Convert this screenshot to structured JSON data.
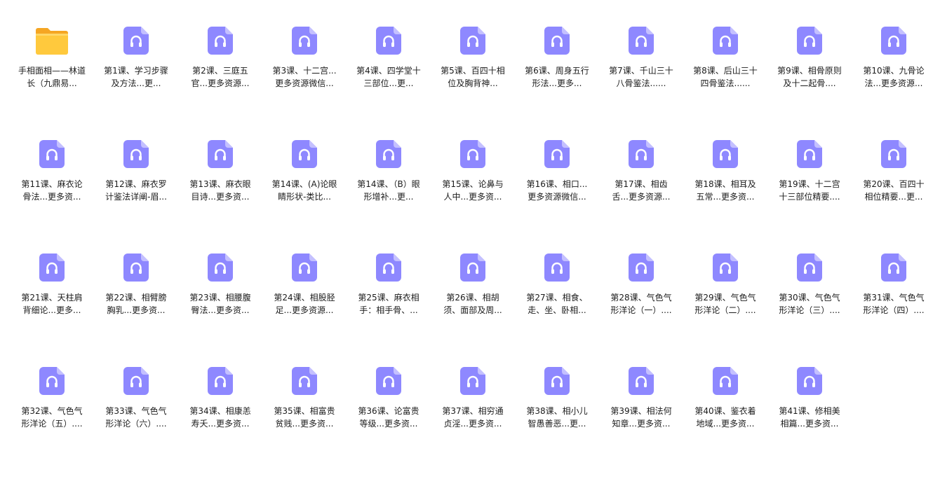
{
  "files": [
    {
      "name": "手相面相——林道长（九鼎易...",
      "icon": "folder-icon"
    },
    {
      "name": "第1课、学习步骤及方法...更...",
      "icon": "audio-file-icon"
    },
    {
      "name": "第2课、三庭五官...更多资源...",
      "icon": "audio-file-icon"
    },
    {
      "name": "第3课、十二宫...更多资源微信...",
      "icon": "audio-file-icon"
    },
    {
      "name": "第4课、四学堂十三部位...更...",
      "icon": "audio-file-icon"
    },
    {
      "name": "第5课、百四十相位及胸背神...",
      "icon": "audio-file-icon"
    },
    {
      "name": "第6课、周身五行形法...更多...",
      "icon": "audio-file-icon"
    },
    {
      "name": "第7课、千山三十八骨鉴法......",
      "icon": "audio-file-icon"
    },
    {
      "name": "第8课、后山三十四骨鉴法......",
      "icon": "audio-file-icon"
    },
    {
      "name": "第9课、相骨原则及十二起骨....",
      "icon": "audio-file-icon"
    },
    {
      "name": "第10课、九骨论法...更多资源...",
      "icon": "audio-file-icon"
    },
    {
      "name": "第11课、麻衣论骨法...更多资...",
      "icon": "audio-file-icon"
    },
    {
      "name": "第12课、麻衣罗计鉴法详阐-眉...",
      "icon": "audio-file-icon"
    },
    {
      "name": "第13课、麻衣眼目诗...更多资...",
      "icon": "audio-file-icon"
    },
    {
      "name": "第14课、(A)论眼睛形状-类比...",
      "icon": "audio-file-icon"
    },
    {
      "name": "第14课、（B）眼形增补...更...",
      "icon": "audio-file-icon"
    },
    {
      "name": "第15课、论鼻与人中...更多资...",
      "icon": "audio-file-icon"
    },
    {
      "name": "第16课、相口...更多资源微信...",
      "icon": "audio-file-icon"
    },
    {
      "name": "第17课、相齿舌...更多资源...",
      "icon": "audio-file-icon"
    },
    {
      "name": "第18课、相耳及五常...更多资...",
      "icon": "audio-file-icon"
    },
    {
      "name": "第19课、十二宫十三部位精要....",
      "icon": "audio-file-icon"
    },
    {
      "name": "第20课、百四十相位精要...更...",
      "icon": "audio-file-icon"
    },
    {
      "name": "第21课、天柱肩背细论...更多...",
      "icon": "audio-file-icon"
    },
    {
      "name": "第22课、相臂膀胸乳...更多资...",
      "icon": "audio-file-icon"
    },
    {
      "name": "第23课、相腰腹臀法...更多资...",
      "icon": "audio-file-icon"
    },
    {
      "name": "第24课、相股胫足...更多资源...",
      "icon": "audio-file-icon"
    },
    {
      "name": "第25课、麻衣相手：相手骨、...",
      "icon": "audio-file-icon"
    },
    {
      "name": "第26课、相胡须、面部及周...",
      "icon": "audio-file-icon"
    },
    {
      "name": "第27课、相食、走、坐、卧相...",
      "icon": "audio-file-icon"
    },
    {
      "name": "第28课、气色气形洋论（一）....",
      "icon": "audio-file-icon"
    },
    {
      "name": "第29课、气色气形洋论（二）....",
      "icon": "audio-file-icon"
    },
    {
      "name": "第30课、气色气形洋论（三）....",
      "icon": "audio-file-icon"
    },
    {
      "name": "第31课、气色气形洋论（四）....",
      "icon": "audio-file-icon"
    },
    {
      "name": "第32课、气色气形洋论（五）....",
      "icon": "audio-file-icon"
    },
    {
      "name": "第33课、气色气形洋论（六）....",
      "icon": "audio-file-icon"
    },
    {
      "name": "第34课、相康恙寿夭...更多资...",
      "icon": "audio-file-icon"
    },
    {
      "name": "第35课、相富贵贫贱...更多资...",
      "icon": "audio-file-icon"
    },
    {
      "name": "第36课、论富贵等级...更多资...",
      "icon": "audio-file-icon"
    },
    {
      "name": "第37课、相穷通贞淫...更多资...",
      "icon": "audio-file-icon"
    },
    {
      "name": "第38课、相小儿智愚善恶...更...",
      "icon": "audio-file-icon"
    },
    {
      "name": "第39课、相法何知章...更多资...",
      "icon": "audio-file-icon"
    },
    {
      "name": "第40课、鉴衣着地域...更多资...",
      "icon": "audio-file-icon"
    },
    {
      "name": "第41课、修相美相篇...更多资...",
      "icon": "audio-file-icon"
    }
  ],
  "colors": {
    "audio_icon": "#8e88ff",
    "audio_icon_fold": "#c4c0ff",
    "folder_body": "#ffc93d",
    "folder_back": "#f5a623",
    "text": "#1c1c1c"
  }
}
